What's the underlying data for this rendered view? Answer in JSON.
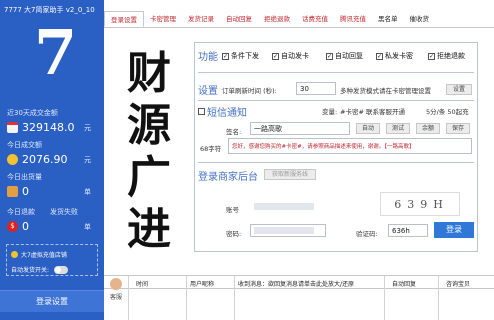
{
  "window": {
    "title": "7777 大7简家助手 v2_0_10"
  },
  "sidebar": {
    "big_number": "7",
    "stats": [
      {
        "label": "近30天成交金额",
        "value": "329148.0",
        "unit": "元",
        "icon": "calendar-icon"
      },
      {
        "label": "今日成交额",
        "value": "2076.90",
        "unit": "元",
        "icon": "coin-icon"
      },
      {
        "label": "今日出货量",
        "value": "0",
        "unit": "单",
        "icon": "box-icon"
      }
    ],
    "refund": {
      "label1": "今日退款",
      "label2": "发货失败",
      "value": "0",
      "unit": "单",
      "icon_text": "$"
    },
    "promo": {
      "title": "大7虚拟充值店铺",
      "toggle_label": "自动发货开关:"
    },
    "login_button": "登录设置"
  },
  "tabs": [
    {
      "label": "登录设置",
      "active": true
    },
    {
      "label": "卡密管理"
    },
    {
      "label": "发货记录"
    },
    {
      "label": "自动回复"
    },
    {
      "label": "拒绝退款"
    },
    {
      "label": "话费充值"
    },
    {
      "label": "腾讯充值"
    },
    {
      "label": "黑名单"
    },
    {
      "label": "催收货"
    }
  ],
  "calligraphy": [
    "财",
    "源",
    "广",
    "进"
  ],
  "features": {
    "title": "功能",
    "options": [
      {
        "label": "条件下发",
        "checked": true
      },
      {
        "label": "自动发卡",
        "checked": true
      },
      {
        "label": "自动回复",
        "checked": true
      },
      {
        "label": "私发卡密",
        "checked": true
      },
      {
        "label": "拒绝退款",
        "checked": true
      }
    ]
  },
  "settings": {
    "title": "设置",
    "refresh_label": "订单刷新时间 (秒):",
    "refresh_value": "30",
    "mode_label": "多种发货模式请在卡密管理设置",
    "button": "设置"
  },
  "sms": {
    "title": "短信通知",
    "var_label": "变量:",
    "var_text": "#卡密# 联系客服开通",
    "limit_text": "5分/条 50起充",
    "sign_label": "签名:",
    "sign_value": "一路高歌",
    "buttons": [
      "自动",
      "测试",
      "余额",
      "保存"
    ],
    "char_label": "68字符",
    "template": "您好，感谢您购买的#卡密#，请参照商品描述来使用，谢谢。【一路高歌】"
  },
  "merchant": {
    "title": "登录商家后台",
    "get_button": "获取新服务线",
    "account_label": "账号",
    "password_label": "密码:",
    "captcha_label": "验证码:",
    "captcha_image": "639H",
    "captcha_value": "636h",
    "login_button": "登录"
  },
  "table": {
    "columns": [
      "时间",
      "用户昵称",
      "收到消息：欲回复消息请单击此处放大/还原",
      "自动回复",
      "咨询宝贝"
    ],
    "avatar_label": "客服"
  }
}
